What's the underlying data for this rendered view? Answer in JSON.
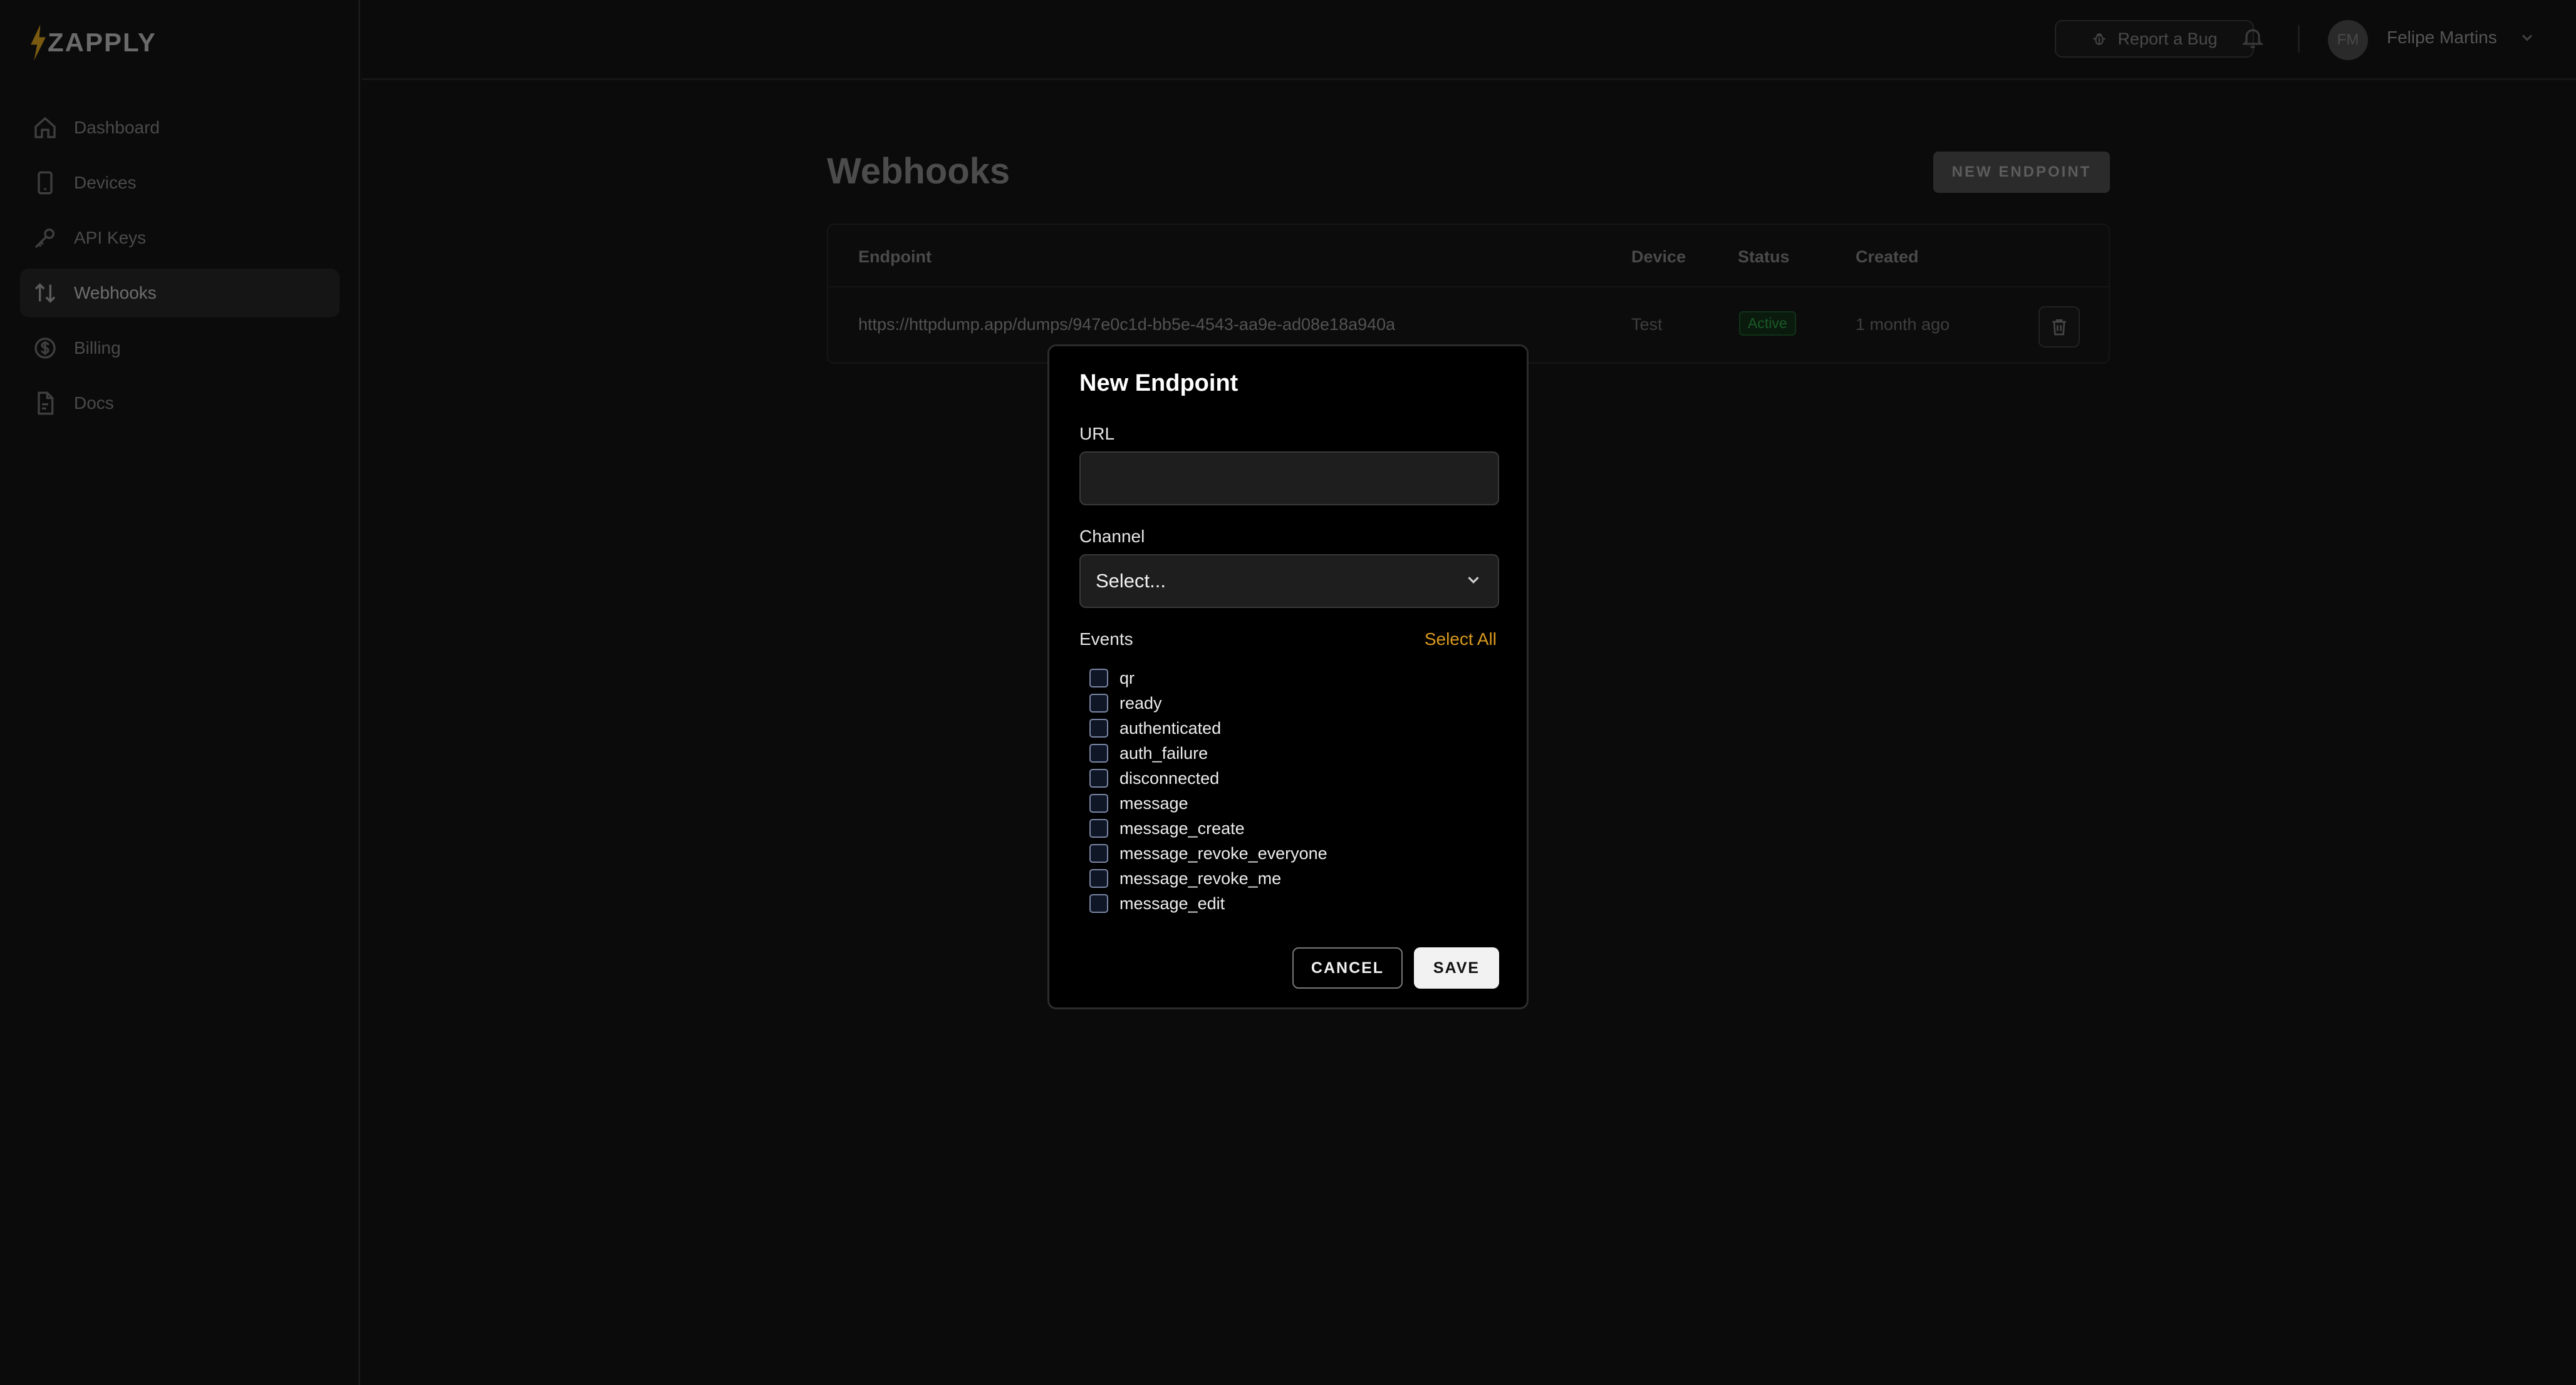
{
  "brand": {
    "name": "ZAPPLY",
    "accent": "#d99a1e"
  },
  "sidebar": {
    "items": [
      {
        "label": "Dashboard",
        "icon": "home-icon"
      },
      {
        "label": "Devices",
        "icon": "phone-icon"
      },
      {
        "label": "API Keys",
        "icon": "key-icon"
      },
      {
        "label": "Webhooks",
        "icon": "arrows-up-down-icon",
        "active": true
      },
      {
        "label": "Billing",
        "icon": "dollar-icon"
      },
      {
        "label": "Docs",
        "icon": "document-icon"
      }
    ]
  },
  "topbar": {
    "report_bug_label": "Report a Bug",
    "user_initials": "FM",
    "user_name": "Felipe Martins"
  },
  "main": {
    "title": "Webhooks",
    "new_endpoint_label": "NEW ENDPOINT",
    "table": {
      "headers": [
        "Endpoint",
        "Device",
        "Status",
        "Created"
      ],
      "rows": [
        {
          "endpoint": "https://httpdump.app/dumps/947e0c1d-bb5e-4543-aa9e-ad08e18a940a",
          "device": "Test",
          "status": "Active",
          "created": "1 month ago"
        }
      ]
    }
  },
  "modal": {
    "title": "New Endpoint",
    "url_label": "URL",
    "url_value": "",
    "channel_label": "Channel",
    "channel_value": "Select...",
    "events_label": "Events",
    "select_all_label": "Select All",
    "events": [
      "qr",
      "ready",
      "authenticated",
      "auth_failure",
      "disconnected",
      "message",
      "message_create",
      "message_revoke_everyone",
      "message_revoke_me",
      "message_edit"
    ],
    "cancel_label": "CANCEL",
    "save_label": "SAVE"
  }
}
